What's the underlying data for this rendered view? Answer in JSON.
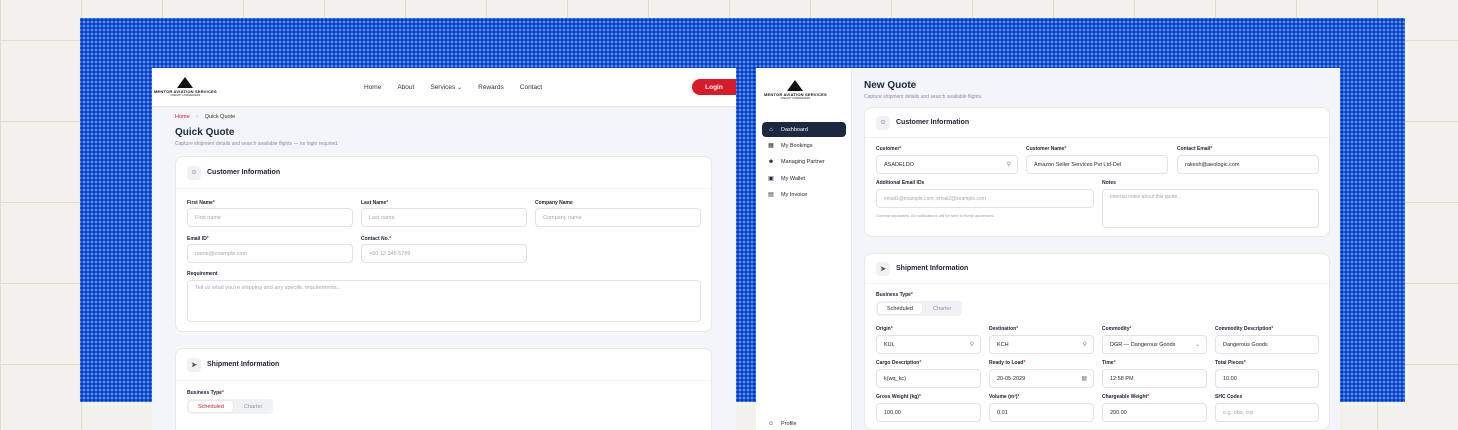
{
  "left": {
    "logo": {
      "line1": "MENTOR AVIATION SERVICES",
      "line2": "FREIGHT FORWARDERS"
    },
    "nav": [
      "Home",
      "About",
      "Services",
      "Rewards",
      "Contact"
    ],
    "services_chevron": "⌄",
    "login": "Login",
    "breadcrumb": {
      "home": "Home",
      "sep": "›",
      "current": "Quick Quote"
    },
    "title": "Quick Quote",
    "subtitle": "Capture shipment details and search available flights — no login required.",
    "customer": {
      "heading": "Customer Information",
      "first_name": {
        "label": "First Name",
        "placeholder": "First name"
      },
      "last_name": {
        "label": "Last Name",
        "placeholder": "Last name"
      },
      "company": {
        "label": "Company Name",
        "placeholder": "Company name"
      },
      "email": {
        "label": "Email ID",
        "placeholder": "name@example.com"
      },
      "contact": {
        "label": "Contact No.",
        "placeholder": "+60 12 345 6789"
      },
      "requirement": {
        "label": "Requirement",
        "placeholder": "Tell us what you're shipping and any specific requirements..."
      }
    },
    "shipment": {
      "heading": "Shipment Information",
      "business_type_label": "Business Type",
      "options": [
        "Scheduled",
        "Charter"
      ]
    }
  },
  "right": {
    "logo": {
      "line1": "MENTOR AVIATION SERVICES",
      "line2": "FREIGHT FORWARDERS"
    },
    "sidebar": [
      "Dashboard",
      "My Bookings",
      "Managing Partner",
      "My Wallet",
      "My Invoice"
    ],
    "profile": "Profile",
    "title": "New Quote",
    "subtitle": "Capture shipment details and search available flights.",
    "customer": {
      "heading": "Customer Information",
      "customer": {
        "label": "Customer",
        "value": "ASADELDO"
      },
      "customer_name": {
        "label": "Customer Name",
        "value": "Amazon Seller Services Pvt Ltd-Del"
      },
      "contact_email": {
        "label": "Contact Email",
        "value": "rakesh@aeologic.com"
      },
      "additional_emails": {
        "label": "Additional Email IDs",
        "placeholder": "email1@example.com, email2@example.com",
        "hint": "Comma separated. All notifications will be sent to these addresses."
      },
      "notes": {
        "label": "Notes",
        "placeholder": "Internal notes about this quote..."
      }
    },
    "shipment": {
      "heading": "Shipment Information",
      "business_type_label": "Business Type",
      "options": [
        "Scheduled",
        "Charter"
      ],
      "origin": {
        "label": "Origin",
        "value": "KUL"
      },
      "destination": {
        "label": "Destination",
        "value": "KCH"
      },
      "commodity": {
        "label": "Commodity",
        "value": "DGR — Dangerous Goods"
      },
      "commodity_desc": {
        "label": "Commodity Description",
        "value": "Dangerous Goods"
      },
      "cargo_desc": {
        "label": "Cargo Description",
        "value": "k(wq_kc)"
      },
      "ready_to_load": {
        "label": "Ready to Load",
        "value": "20-05-2029"
      },
      "time": {
        "label": "Time",
        "value": "12:58 PM"
      },
      "total_pieces": {
        "label": "Total Pieces",
        "value": "10.00"
      },
      "gross_weight": {
        "label": "Gross Weight (kg)",
        "value": "100.00"
      },
      "volume": {
        "label": "Volume (m³)",
        "value": "0.01"
      },
      "chargeable_weight": {
        "label": "Chargeable Weight",
        "value": "200.00"
      },
      "shc_codes": {
        "label": "SHC Codes",
        "placeholder": "e.g. obs, crp"
      }
    }
  }
}
